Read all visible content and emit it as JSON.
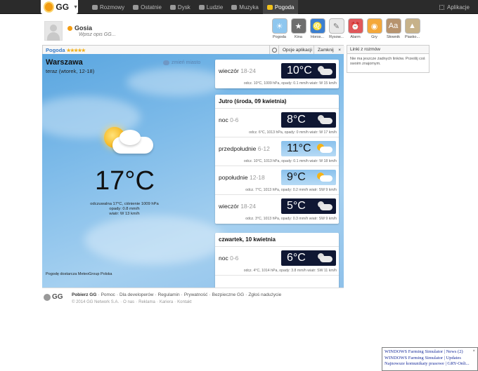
{
  "topbar": {
    "logo": "GG",
    "nav": [
      {
        "label": "Rozmowy",
        "icon": "chat-icon"
      },
      {
        "label": "Ostatnie",
        "icon": "clock-icon"
      },
      {
        "label": "Dysk",
        "icon": "folder-icon"
      },
      {
        "label": "Ludzie",
        "icon": "people-icon"
      },
      {
        "label": "Muzyka",
        "icon": "headphones-icon"
      },
      {
        "label": "Pogoda",
        "icon": "sun-icon",
        "active": true
      }
    ],
    "apps_label": "Aplikacje"
  },
  "profile": {
    "name": "Gosia",
    "status_placeholder": "Wpisz opis GG..."
  },
  "app_icons": [
    {
      "label": "Pogoda",
      "color": "#8fc7ef",
      "icon": "weather-icon"
    },
    {
      "label": "Kina",
      "color": "#6e6e6e",
      "icon": "film-icon"
    },
    {
      "label": "Horos...",
      "color": "#3c7fd0",
      "icon": "horoscope-icon"
    },
    {
      "label": "Rysow...",
      "color": "#e9e9e9",
      "icon": "pencil-icon"
    },
    {
      "label": "Alarm",
      "color": "#e0575a",
      "icon": "alarm-icon"
    },
    {
      "label": "Gry",
      "color": "#f4a83a",
      "icon": "gamepad-icon"
    },
    {
      "label": "Słownik",
      "color": "#b7936e",
      "icon": "dictionary-icon"
    },
    {
      "label": "Piasko...",
      "color": "#c7b28a",
      "icon": "sandbox-icon"
    }
  ],
  "widget": {
    "title": "Pogoda",
    "stars": "★★★★★",
    "options_label": "Opcje aplikacji",
    "close_label": "Zamknij",
    "close_x": "×"
  },
  "weather": {
    "city": "Warszawa",
    "now_label": "teraz (wtorek, 12-18)",
    "change_city": "zmień miasto",
    "temp": "17°C",
    "details": [
      "odczuwalna 17°C, ciśnienie 1009 hPa",
      "opady: 0.8 mm/h",
      "wiatr: W 13 km/h"
    ],
    "provider": "Pogodę dostarcza MeteoGroup Polska"
  },
  "forecast": {
    "today": {
      "period": "wieczór",
      "hours": "18-24",
      "temp": "10°C",
      "info": "odcz. 10°C, 1009 hPa, opady: 0.1 mm/h wiatr: W 15 km/h"
    },
    "tomorrow": {
      "header": "Jutro (środa, 09 kwietnia)",
      "rows": [
        {
          "period": "noc",
          "hours": "0-6",
          "temp": "8°C",
          "night": true,
          "info": "odcz. 6°C, 1013 hPa, opady: 0 mm/h wiatr: W 17 km/h"
        },
        {
          "period": "przedpołudnie",
          "hours": "6-12",
          "temp": "11°C",
          "night": false,
          "info": "odcz. 10°C, 1013 hPa, opady: 0.1 mm/h wiatr: W 18 km/h"
        },
        {
          "period": "popołudnie",
          "hours": "12-18",
          "temp": "9°C",
          "night": false,
          "info": "odcz. 7°C, 1013 hPa, opady: 0.2 mm/h wiatr: SW 9 km/h"
        },
        {
          "period": "wieczór",
          "hours": "18-24",
          "temp": "5°C",
          "night": true,
          "info": "odcz. 3°C, 1013 hPa, opady: 0.3 mm/h wiatr: SW 9 km/h"
        }
      ]
    },
    "thursday": {
      "header": "czwartek, 10 kwietnia",
      "rows": [
        {
          "period": "noc",
          "hours": "0-6",
          "temp": "6°C",
          "night": true,
          "info": "odcz. 4°C, 1014 hPa, opady: 3.8 mm/h wiatr: SW 11 km/h"
        }
      ]
    }
  },
  "links": {
    "title": "Linki z rozmów",
    "body": "Nie ma jeszcze żadnych linków. Prześlij coś swoim znajomym."
  },
  "footer": {
    "logo": "GG",
    "links": [
      "Pobierz GG",
      "Pomoc",
      "Dla developerów",
      "Regulamin",
      "Prywatność",
      "Bezpieczne GG",
      "Zgłoś nadużycie"
    ],
    "links2": [
      "© 2014 GG Network S.A.",
      "O nas",
      "Reklama",
      "Kariera",
      "Kontakt"
    ]
  },
  "popup": {
    "lines": [
      "WINDOWS Farming Simulator | News (2)",
      "WINDOWS Farming Simulator | Updates",
      "Najnowsze komunikaty prasowe | GRY-Onli..."
    ],
    "close": "×"
  }
}
